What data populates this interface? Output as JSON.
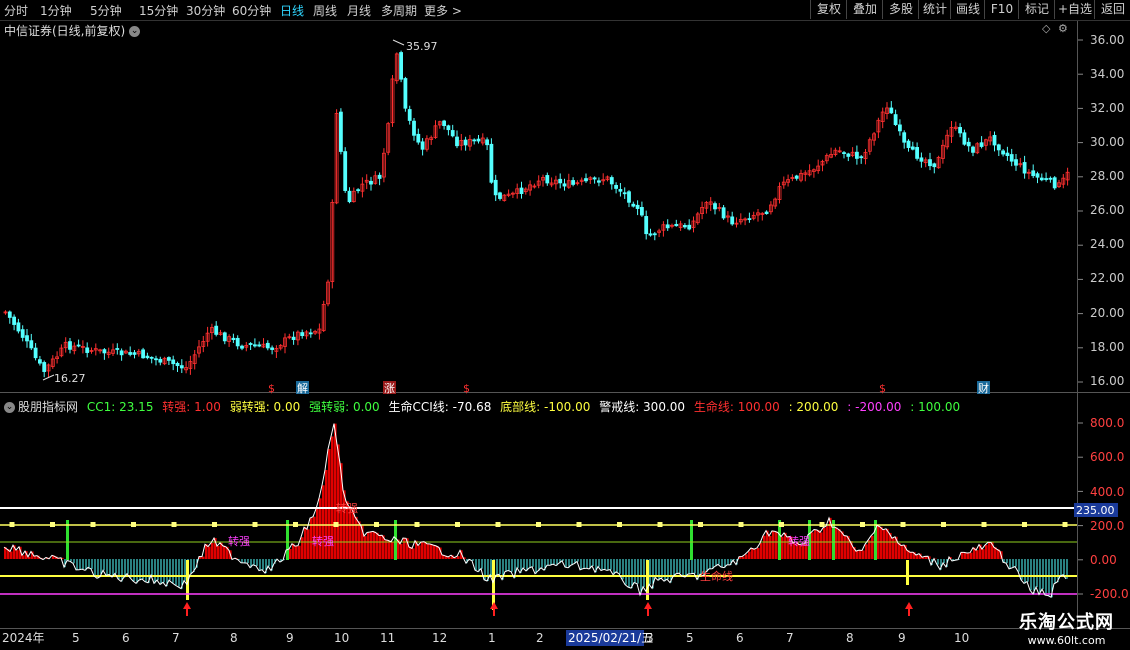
{
  "toolbar": {
    "periods": [
      "分时",
      "1分钟",
      "5分钟",
      "15分钟",
      "30分钟",
      "60分钟",
      "日线",
      "周线",
      "月线",
      "多周期",
      "更多 >"
    ],
    "active_period": "日线",
    "right_buttons": [
      "复权",
      "叠加",
      "多股",
      "统计",
      "画线",
      "F10",
      "标记",
      "+自选",
      "返回"
    ]
  },
  "main_chart": {
    "title": "中信证券(日线,前复权)",
    "price_labels": [
      "36.00",
      "34.00",
      "32.00",
      "30.00",
      "28.00",
      "26.00",
      "24.00",
      "22.00",
      "20.00",
      "18.00",
      "16.00"
    ],
    "high_label": "35.97",
    "low_label": "16.27",
    "event_markers": [
      "$",
      "解",
      "涨",
      "$",
      "$",
      "财"
    ]
  },
  "indicator": {
    "name": "股朋指标网",
    "values": [
      {
        "label": "CC1: 23.15",
        "color": "#3fff3f"
      },
      {
        "label": "转强: 1.00",
        "color": "#ff3030"
      },
      {
        "label": "弱转强: 0.00",
        "color": "#ffff40"
      },
      {
        "label": "强转弱: 0.00",
        "color": "#3fff3f"
      },
      {
        "label": "生命CCI线: -70.68",
        "color": "#ffffff"
      },
      {
        "label": "底部线: -100.00",
        "color": "#ffff40"
      },
      {
        "label": "警戒线: 300.00",
        "color": "#ffffff"
      },
      {
        "label": "生命线: 100.00",
        "color": "#ff3030"
      },
      {
        "label": ": 200.00",
        "color": "#ffff40"
      },
      {
        "label": ": -200.00",
        "color": "#ff40ff"
      },
      {
        "label": ": 100.00",
        "color": "#3fff3f"
      }
    ],
    "axis_labels": [
      "800.0",
      "600.0",
      "400.0",
      "200.0",
      "0.00",
      "-200.0"
    ],
    "current_value": "235.00",
    "annotations": [
      "转强",
      "转强",
      "转强",
      "转强",
      "生命线"
    ]
  },
  "time_axis": {
    "labels": [
      "2024年",
      "5",
      "6",
      "7",
      "8",
      "9",
      "10",
      "11",
      "12",
      "1",
      "2",
      "3",
      "5",
      "6",
      "7",
      "8",
      "9",
      "10"
    ],
    "cursor_date": "2025/02/21/五"
  },
  "watermark": {
    "main": "乐淘公式网",
    "sub": "www.60lt.com"
  },
  "colors": {
    "up": "#ff3030",
    "down": "#54ffff",
    "cyan_active": "#2fd6ff",
    "indicator_red": "#e00000"
  }
}
